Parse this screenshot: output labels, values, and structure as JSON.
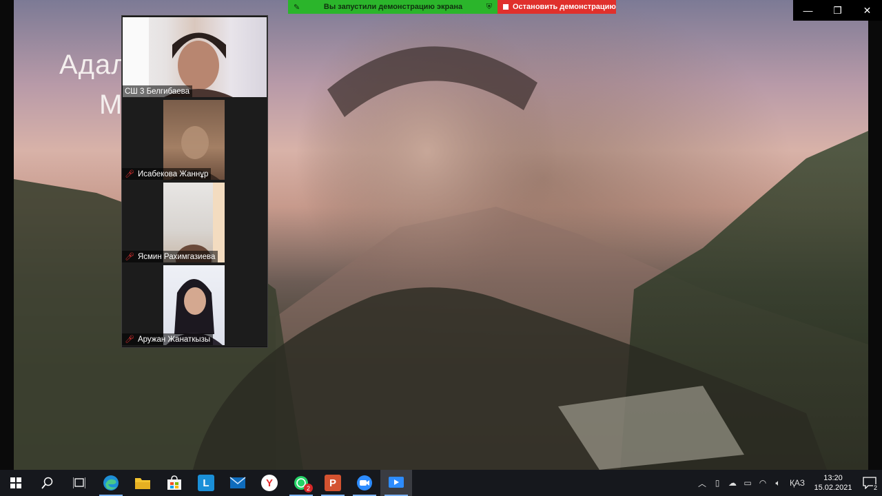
{
  "share_bar": {
    "status_text": "Вы запустили демонстрацию экрана",
    "stop_label": "Остановить демонстрацию"
  },
  "window_controls": {
    "minimize": "—",
    "restore": "❐",
    "close": "✕"
  },
  "slide": {
    "title_line1": "Адал",
    "title_line2": "М"
  },
  "participants": [
    {
      "name": "СШ 3 Белгибаева",
      "muted": false
    },
    {
      "name": "Исабекова Жаннұр",
      "muted": true
    },
    {
      "name": "Ясмин Рахимгазиева",
      "muted": true
    },
    {
      "name": "Аружан Жанаткызы",
      "muted": true
    }
  ],
  "taskbar": {
    "items": [
      {
        "name": "start",
        "icon": "windows-icon"
      },
      {
        "name": "search",
        "icon": "search-icon"
      },
      {
        "name": "task-view",
        "icon": "task-view-icon"
      },
      {
        "name": "edge",
        "icon": "edge-icon"
      },
      {
        "name": "file-explorer",
        "icon": "folder-icon"
      },
      {
        "name": "store",
        "icon": "store-icon"
      },
      {
        "name": "l-app",
        "icon": "l-app-icon",
        "glyph": "L"
      },
      {
        "name": "mail",
        "icon": "mail-icon"
      },
      {
        "name": "yandex",
        "icon": "yandex-icon",
        "glyph": "Y"
      },
      {
        "name": "whatsapp",
        "icon": "whatsapp-icon",
        "badge": "2"
      },
      {
        "name": "powerpoint",
        "icon": "powerpoint-icon",
        "glyph": "P"
      },
      {
        "name": "zoom",
        "icon": "zoom-icon"
      },
      {
        "name": "zoom-share",
        "icon": "zoom-share-icon"
      }
    ],
    "tray": {
      "language": "ҚАЗ",
      "time": "13:20",
      "date": "15.02.2021",
      "notification_count": "2"
    }
  },
  "colors": {
    "share_green": "#2bb52b",
    "stop_red": "#e0302c",
    "taskbar_bg": "#16181d"
  }
}
